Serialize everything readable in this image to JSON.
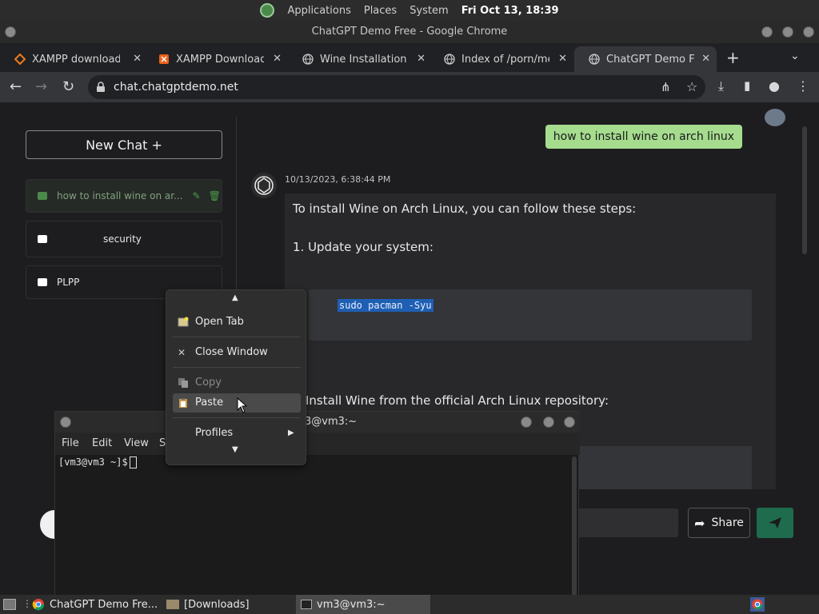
{
  "top_panel": {
    "applications": "Applications",
    "places": "Places",
    "system": "System",
    "clock": "Fri Oct 13, 18:39"
  },
  "window_title": "ChatGPT Demo Free - Google Chrome",
  "tabs": [
    {
      "label": "XAMPP download |",
      "icon": "xampp-icon"
    },
    {
      "label": "XAMPP Download",
      "icon": "xampp-icon"
    },
    {
      "label": "Wine Installation a",
      "icon": "globe-icon"
    },
    {
      "label": "Index of /porn/med",
      "icon": "globe-icon"
    },
    {
      "label": "ChatGPT Demo Fre",
      "icon": "globe-icon",
      "active": true
    }
  ],
  "address_bar": {
    "url": "chat.chatgptdemo.net"
  },
  "sidebar": {
    "new_chat_label": "New Chat +",
    "conversations": [
      {
        "label": "how to install wine on ar..."
      },
      {
        "label": "security"
      },
      {
        "label": "PLPP"
      }
    ]
  },
  "chat": {
    "user_message": "how to install wine on arch linux",
    "timestamp": "10/13/2023, 6:38:44 PM",
    "answer_intro": "To install Wine on Arch Linux, you can follow these steps:",
    "step1": "1. Update your system:",
    "code1": "sudo pacman -Syu",
    "step2": "Install Wine from the official Arch Linux repository:",
    "share_label": "Share"
  },
  "terminal": {
    "title": "3@vm3:~",
    "menu": [
      "File",
      "Edit",
      "View",
      "S"
    ],
    "prompt": "[vm3@vm3 ~]$"
  },
  "context_menu": {
    "items": [
      "Open Tab",
      "Close Window",
      "Copy",
      "Paste",
      "Profiles"
    ]
  },
  "taskbar": {
    "items": [
      "ChatGPT Demo Fre...",
      "[Downloads]",
      "vm3@vm3:~"
    ]
  },
  "colors": {
    "user_bubble": "#a5dc8e",
    "send_button": "#1f6b4e",
    "selection": "#1f5fb3"
  }
}
